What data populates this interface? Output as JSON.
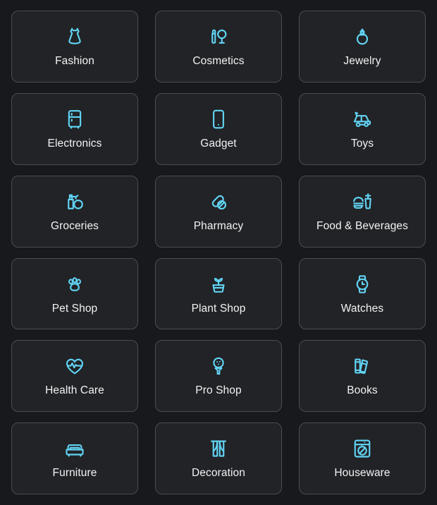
{
  "theme": {
    "background": "#17191c",
    "card_background": "#212326",
    "card_border": "#4a4d51",
    "icon_color": "#62d4f5",
    "label_color": "#f2f3f4"
  },
  "grid": {
    "columns": 3,
    "rows": 6,
    "categories": [
      {
        "label": "Fashion",
        "icon": "dress-icon"
      },
      {
        "label": "Cosmetics",
        "icon": "lipstick-mirror-icon"
      },
      {
        "label": "Jewelry",
        "icon": "ring-icon"
      },
      {
        "label": "Electronics",
        "icon": "refrigerator-icon"
      },
      {
        "label": "Gadget",
        "icon": "smartphone-icon"
      },
      {
        "label": "Toys",
        "icon": "toy-car-icon"
      },
      {
        "label": "Groceries",
        "icon": "grocery-bottle-icon"
      },
      {
        "label": "Pharmacy",
        "icon": "pills-icon"
      },
      {
        "label": "Food & Beverages",
        "icon": "burger-drink-icon"
      },
      {
        "label": "Pet Shop",
        "icon": "paw-print-icon"
      },
      {
        "label": "Plant Shop",
        "icon": "potted-plant-icon"
      },
      {
        "label": "Watches",
        "icon": "wristwatch-icon"
      },
      {
        "label": "Health Care",
        "icon": "heart-pulse-icon"
      },
      {
        "label": "Pro Shop",
        "icon": "golf-ball-tee-icon"
      },
      {
        "label": "Books",
        "icon": "books-icon"
      },
      {
        "label": "Furniture",
        "icon": "sofa-icon"
      },
      {
        "label": "Decoration",
        "icon": "curtains-icon"
      },
      {
        "label": "Houseware",
        "icon": "washing-machine-icon"
      }
    ]
  }
}
